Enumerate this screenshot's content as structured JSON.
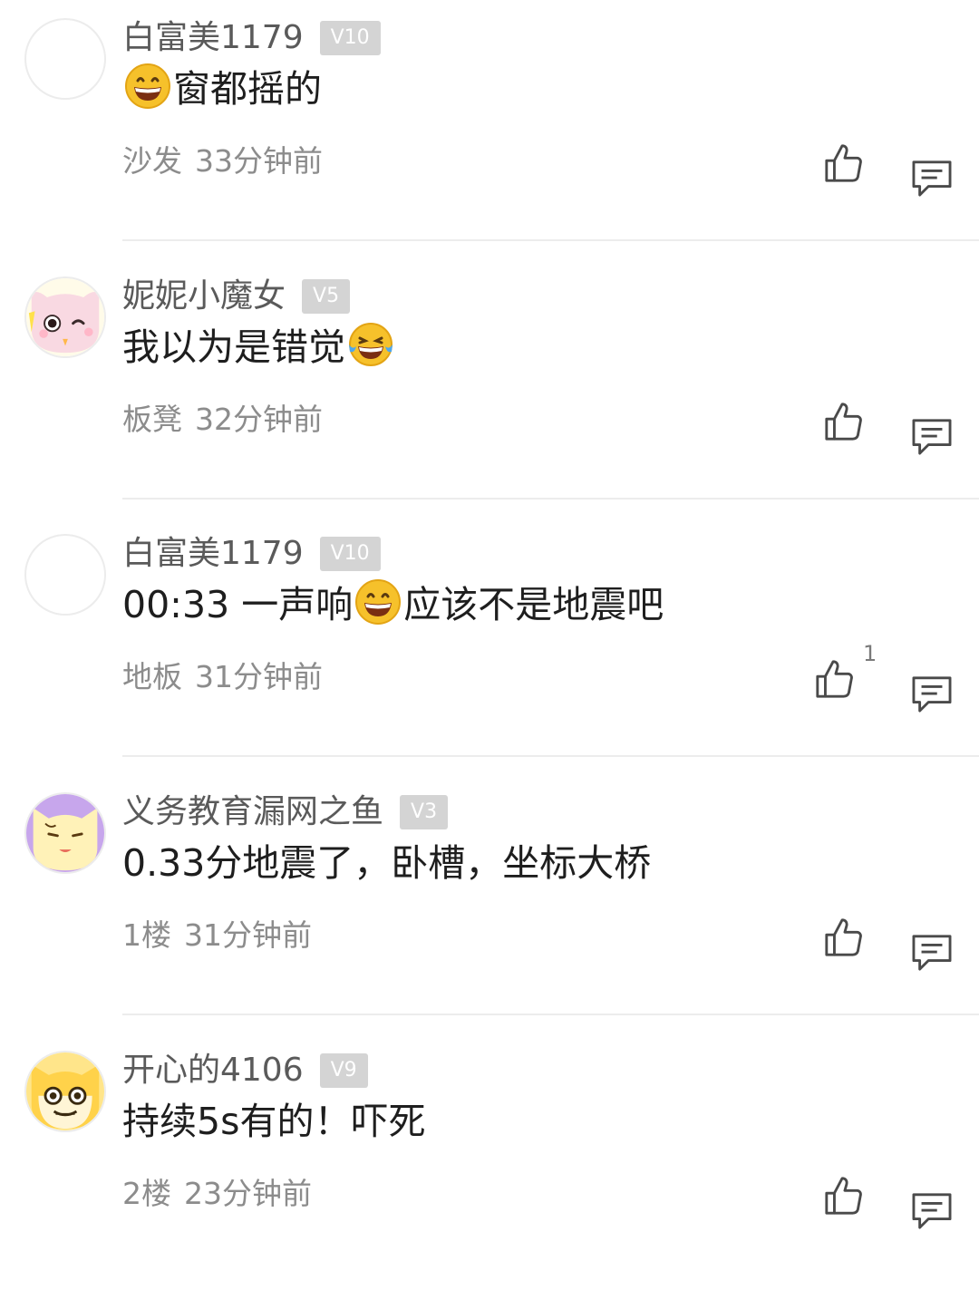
{
  "comments": [
    {
      "username": "白富美1179",
      "level": "V10",
      "text_parts": [
        "",
        "窗都摇的"
      ],
      "floor": "沙发",
      "time": "33分钟前",
      "like_count": ""
    },
    {
      "username": "妮妮小魔女",
      "level": "V5",
      "text_parts": [
        "我以为是错觉",
        ""
      ],
      "floor": "板凳",
      "time": "32分钟前",
      "like_count": ""
    },
    {
      "username": "白富美1179",
      "level": "V10",
      "text_parts": [
        "00:33 一声响",
        "应该不是地震吧"
      ],
      "floor": "地板",
      "time": "31分钟前",
      "like_count": "1"
    },
    {
      "username": "义务教育漏网之鱼",
      "level": "V3",
      "text_parts": [
        "0.33分地震了，卧槽，坐标大桥"
      ],
      "floor": "1楼",
      "time": "31分钟前",
      "like_count": ""
    },
    {
      "username": "开心的4106",
      "level": "V9",
      "text_parts": [
        "持续5s有的！吓死"
      ],
      "floor": "2楼",
      "time": "23分钟前",
      "like_count": ""
    }
  ],
  "icons": {
    "like": "thumbs-up-icon",
    "reply": "comment-bubble-icon",
    "grin_emoji": "grinning-face-emoji",
    "tears_emoji": "tears-of-joy-emoji"
  },
  "colors": {
    "badge": "#d4d4d4",
    "meta_text": "#8c8c8c",
    "divider": "#ececec"
  }
}
